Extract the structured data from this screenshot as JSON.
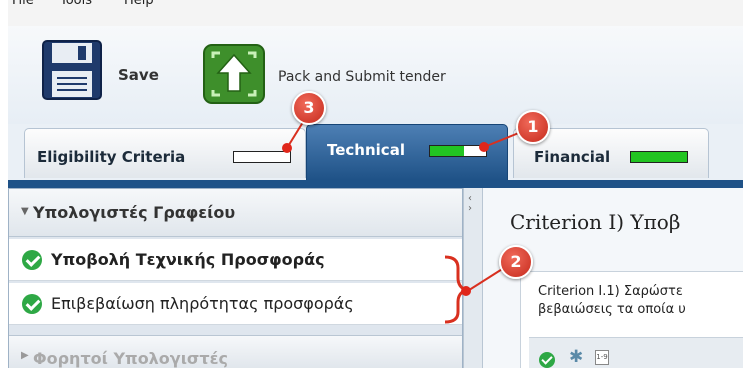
{
  "menu": [
    "File",
    "Tools",
    "Help"
  ],
  "toolbar": {
    "save_label": "Save",
    "pack_label": "Pack and Submit tender"
  },
  "tabs": [
    {
      "label": "Eligibility Criteria",
      "progress_fraction": 0.0
    },
    {
      "label": "Technical",
      "progress_fraction": 0.6
    },
    {
      "label": "Financial",
      "progress_fraction": 1.0
    }
  ],
  "sidebar": {
    "group1_title": "Υπολογιστές Γραφείου",
    "items": [
      {
        "label": "Υποβολή Τεχνικής Προσφοράς"
      },
      {
        "label": "Επιβεβαίωση πληρότητας προσφοράς"
      }
    ],
    "group2_title": "Φορητοί Υπολογιστές"
  },
  "main": {
    "criterion_title": "Criterion I) Υποβ",
    "sub_line1": "Criterion I.1) Σαρώστε",
    "sub_line2": "βεβαιώσεις τα οποία υ",
    "num_icon_text": "1-9"
  },
  "annotations": {
    "badge1": "1",
    "badge2": "2",
    "badge3": "3"
  },
  "colors": {
    "tab_active": "#1f5287",
    "progress_green": "#22c422",
    "annotation_red": "#d9301f",
    "check_green": "#2ea845"
  }
}
